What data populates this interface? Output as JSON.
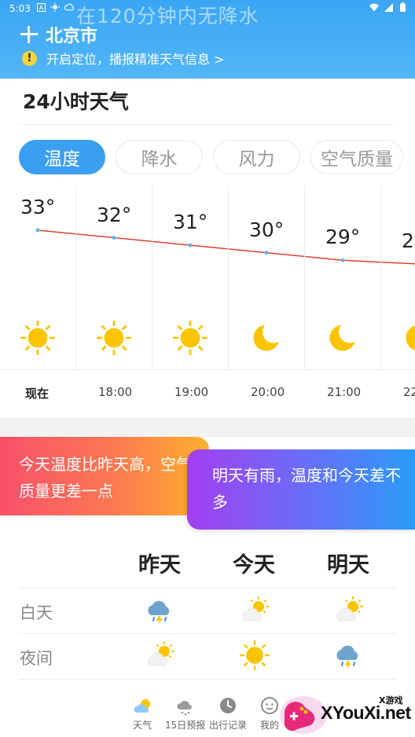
{
  "status_bar": {
    "time": "5:03",
    "left_icons": [
      "notification-a-icon",
      "sun-status-icon",
      "weather-status-icon"
    ],
    "right_icons": [
      "wifi-icon",
      "signal-icon",
      "battery-icon"
    ]
  },
  "header": {
    "banner": "在120分钟内无降水",
    "city": "北京市",
    "locate_prompt": "开启定位，播报精准天气信息 >",
    "warn_glyph": "!"
  },
  "hourly_section": {
    "title": "24小时天气",
    "tabs": [
      {
        "label": "温度",
        "active": true
      },
      {
        "label": "降水",
        "active": false
      },
      {
        "label": "风力",
        "active": false
      },
      {
        "label": "空气质量",
        "active": false
      }
    ],
    "hours": [
      {
        "time": "现在",
        "temp": "33°",
        "value": 33,
        "icon": "sun-icon"
      },
      {
        "time": "18:00",
        "temp": "32°",
        "value": 32,
        "icon": "sun-icon"
      },
      {
        "time": "19:00",
        "temp": "31°",
        "value": 31,
        "icon": "sun-icon"
      },
      {
        "time": "20:00",
        "temp": "30°",
        "value": 30,
        "icon": "moon-icon"
      },
      {
        "time": "21:00",
        "temp": "29°",
        "value": 29,
        "icon": "moon-icon"
      },
      {
        "time": "22",
        "temp": "2",
        "value": 28.5,
        "icon": "moon-icon"
      }
    ]
  },
  "compare": {
    "today_text": "今天温度比昨天高，空气质量更差一点",
    "tomorrow_text": "明天有雨，温度和今天差不多"
  },
  "day_night": {
    "columns": [
      "昨天",
      "今天",
      "明天"
    ],
    "rows": [
      {
        "label": "白天",
        "icons": [
          "thunder-rain-icon",
          "partly-cloudy-icon",
          "partly-cloudy-icon"
        ]
      },
      {
        "label": "夜间",
        "icons": [
          "partly-cloudy-icon",
          "sun-icon",
          "thunder-rain-icon"
        ]
      }
    ]
  },
  "bottom_nav": [
    {
      "label": "天气",
      "icon": "weather-tab-icon",
      "active": true
    },
    {
      "label": "15日预报",
      "icon": "forecast-tab-icon",
      "active": false
    },
    {
      "label": "出行记录",
      "icon": "clock-tab-icon",
      "active": false
    },
    {
      "label": "我的",
      "icon": "profile-tab-icon",
      "active": false
    }
  ],
  "watermark": {
    "brand": "XYouXi.net",
    "small": "X游戏"
  },
  "colors": {
    "header_blue": "#3aa6f3",
    "tab_active": "#3a9ff0",
    "temp_line": "#e0412f",
    "sun": "#fbc400",
    "moon": "#fbc400"
  }
}
